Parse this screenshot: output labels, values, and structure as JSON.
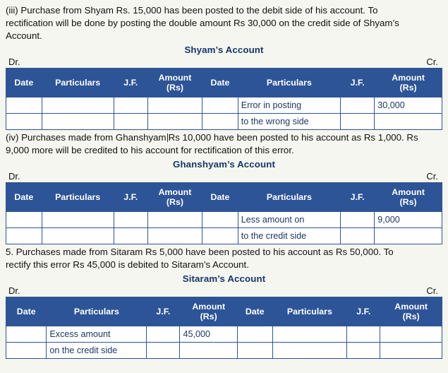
{
  "paragraphs": {
    "p_iii_line1": "(iii) Purchase from Shyam Rs. 15,000 has been posted to the debit side of his account. To",
    "p_iii_line2": "rectification will be done by posting the double amount Rs 30,000 on the credit side of Shyam’s",
    "p_iii_line3": "Account.",
    "p_iv_part1": "(iv) Purchases made from Ghanshyam",
    "p_iv_part2": "Rs 10,000 have been posted to his account as Rs 1,000. Rs",
    "p_iv_line2": "9,000 more will be credited to his account for rectification of this error.",
    "p_v_line1": "5. Purchases made from Sitaram Rs 5,000 have been posted to his account as Rs 50,000. To",
    "p_v_line2": "rectify this error Rs 45,000 is debited to Sitaram’s Account."
  },
  "common": {
    "dr": "Dr.",
    "cr": "Cr.",
    "headers": {
      "date": "Date",
      "particulars": "Particulars",
      "jf": "J.F.",
      "amount": "Amount",
      "amount_unit": "(Rs)"
    }
  },
  "accounts": [
    {
      "title": "Shyam’s Account",
      "dr": "Dr.",
      "cr": "Cr.",
      "rows": [
        {
          "date": "",
          "particulars": "",
          "jf": "",
          "amount": "",
          "date2": "",
          "particulars2": "Error in posting",
          "jf2": "",
          "amount2": "30,000"
        },
        {
          "date": "",
          "particulars": "",
          "jf": "",
          "amount": "",
          "date2": "",
          "particulars2": "to the wrong side",
          "jf2": "",
          "amount2": ""
        }
      ]
    },
    {
      "title": "Ghanshyam’s Account",
      "dr": "Dr.",
      "cr": "Cr.",
      "rows": [
        {
          "date": "",
          "particulars": "",
          "jf": "",
          "amount": "",
          "date2": "",
          "particulars2": "Less amount on",
          "jf2": "",
          "amount2": "9,000"
        },
        {
          "date": "",
          "particulars": "",
          "jf": "",
          "amount": "",
          "date2": "",
          "particulars2": "to the credit side",
          "jf2": "",
          "amount2": ""
        }
      ]
    },
    {
      "title": "Sitaram’s Account",
      "dr": "Dr.",
      "cr": "Cr.",
      "rows": [
        {
          "date": "",
          "particulars": "Excess amount",
          "jf": "",
          "amount": "45,000",
          "date2": "",
          "particulars2": "",
          "jf2": "",
          "amount2": ""
        },
        {
          "date": "",
          "particulars": "on the credit side",
          "jf": "",
          "amount": "",
          "date2": "",
          "particulars2": "",
          "jf2": "",
          "amount2": ""
        }
      ]
    }
  ],
  "colors": {
    "header_bg": "#2d5496",
    "heading_text": "#16366b",
    "cell_text": "#1f3864",
    "page_bg": "#f5f6ef"
  }
}
